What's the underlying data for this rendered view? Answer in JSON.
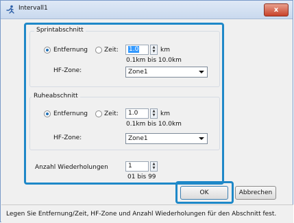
{
  "window": {
    "title": "Intervall1",
    "close_glyph": "x"
  },
  "sprint": {
    "legend": "Sprintabschnitt",
    "radio_distance": "Entfernung",
    "radio_time": "Zeit:",
    "value": "1.0",
    "unit": "km",
    "range": "0.1km bis 10.0km",
    "hf_label": "HF-Zone:",
    "hf_value": "Zone1"
  },
  "rest": {
    "legend": "Ruheabschnitt",
    "radio_distance": "Entfernung",
    "radio_time": "Zeit:",
    "value": "1.0",
    "unit": "km",
    "range": "0.1km bis 10.0km",
    "hf_label": "HF-Zone:",
    "hf_value": "Zone1"
  },
  "repeats": {
    "label": "Anzahl Wiederholungen",
    "value": "1",
    "range": "01 bis 99"
  },
  "buttons": {
    "ok": "OK",
    "cancel": "Abbrechen"
  },
  "status": {
    "text": "Legen Sie Entfernung/Zeit, HF-Zone und Anzahl Wiederholungen für den Abschnitt fest."
  },
  "colors": {
    "highlight": "#1e88c8",
    "selected_radio": "#1f6fb5"
  }
}
